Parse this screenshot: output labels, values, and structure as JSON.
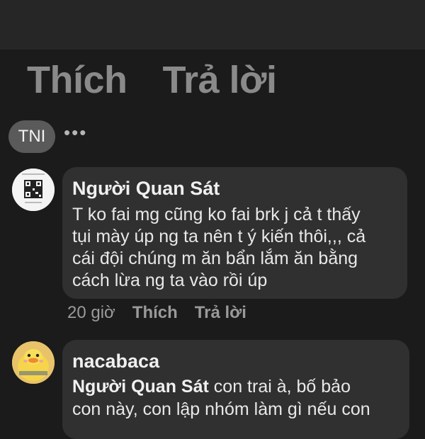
{
  "prev_comment": {
    "like_label": "Thích",
    "reply_label": "Trả lời"
  },
  "tni_badge": "TNI",
  "more_icon": "more-horizontal-icon",
  "comments": [
    {
      "author": "Người Quan Sát",
      "lines": [
        "T ko fai mg cũng ko fai brk j cả t thấy",
        "tụi mày úp ng ta nên t ý kiến thôi,,, cả",
        "cái đội chúng  m ăn bẩn lắm ăn bằng",
        "cách lừa ng ta vào rồi úp"
      ],
      "time": "20 giờ",
      "like_label": "Thích",
      "reply_label": "Trả lời",
      "avatar": "qr-code-avatar"
    },
    {
      "author": "nacabaca",
      "mention": "Người Quan Sát",
      "line1_rest": " con trai à, bố bảo",
      "line2": "con này, con lập nhóm làm gì nếu con",
      "avatar": "yellow-duck-avatar"
    }
  ],
  "colors": {
    "background": "#1b1b1b",
    "bubble": "#303030",
    "secondary_text": "#9a9a9a"
  }
}
